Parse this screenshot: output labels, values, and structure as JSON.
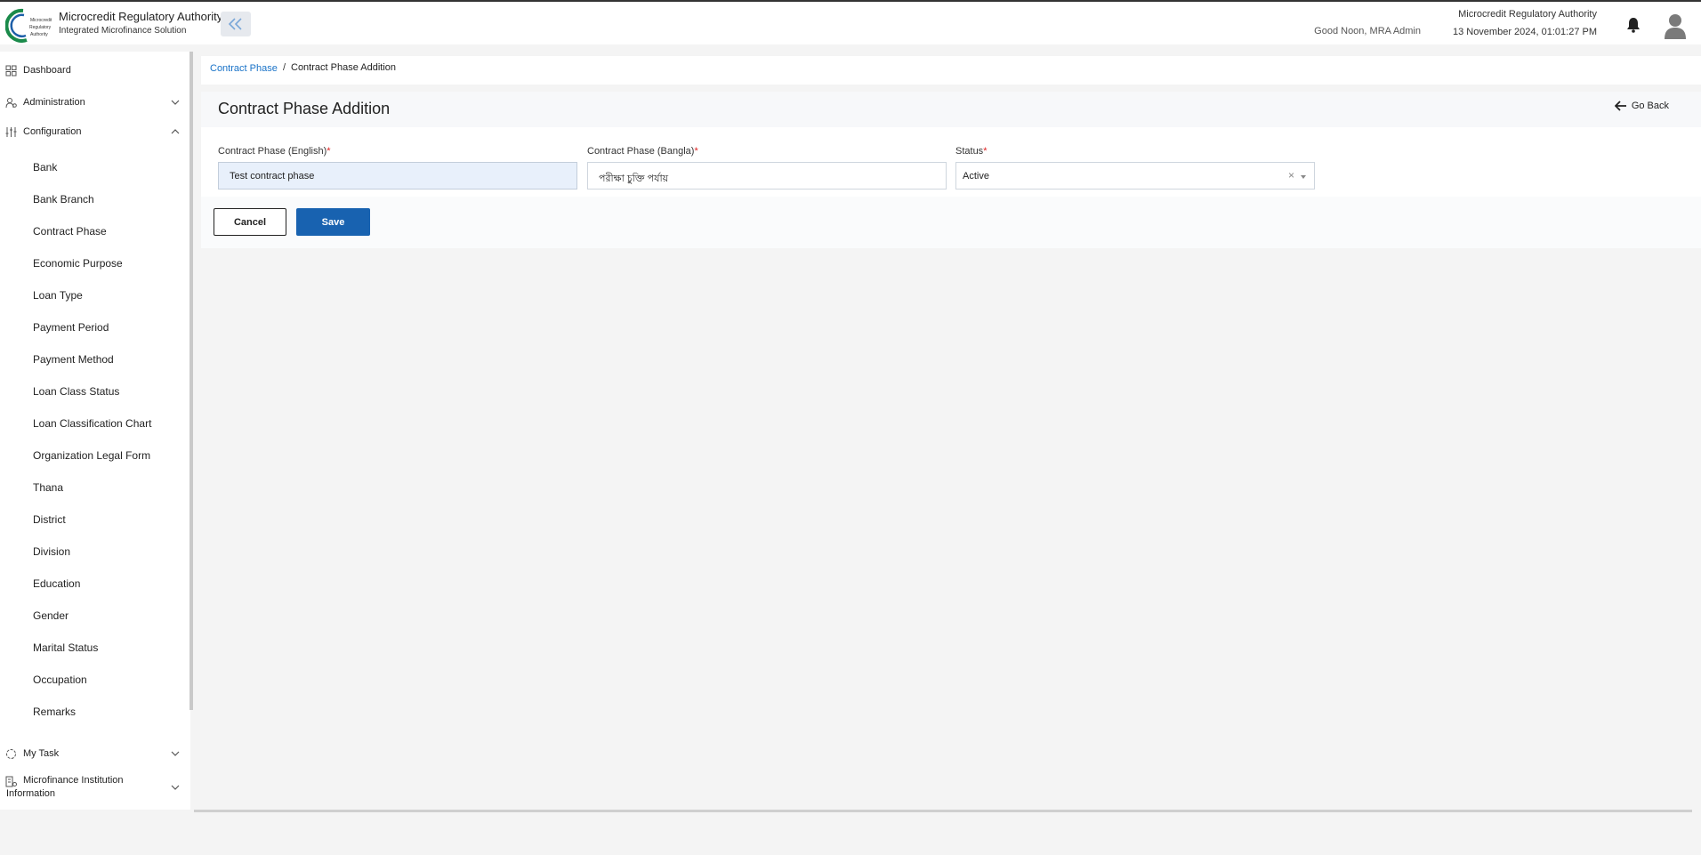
{
  "header": {
    "app_title": "Microcredit Regulatory Authority",
    "app_subtitle": "Integrated Microfinance Solution",
    "logo_text": "Microcredit Regulatory Authority",
    "greeting": "Good Noon, MRA Admin",
    "org_name": "Microcredit Regulatory Authority",
    "datetime": "13 November 2024, 01:01:27 PM"
  },
  "sidebar": {
    "dashboard": "Dashboard",
    "administration": "Administration",
    "configuration": "Configuration",
    "config_items": [
      "Bank",
      "Bank Branch",
      "Contract Phase",
      "Economic Purpose",
      "Loan Type",
      "Payment Period",
      "Payment Method",
      "Loan Class Status",
      "Loan Classification Chart",
      "Organization Legal Form",
      "Thana",
      "District",
      "Division",
      "Education",
      "Gender",
      "Marital Status",
      "Occupation",
      "Remarks"
    ],
    "my_task": "My Task",
    "mfi_info": "Microfinance Institution Information"
  },
  "breadcrumb": {
    "parent": "Contract Phase",
    "separator": "/",
    "current": "Contract Phase Addition"
  },
  "page": {
    "title": "Contract Phase Addition",
    "go_back": "Go Back"
  },
  "form": {
    "english_label": "Contract Phase (English)",
    "english_value": "Test contract phase",
    "bangla_label": "Contract Phase (Bangla)",
    "bangla_value": "পরীক্ষা চুক্তি পর্যায়",
    "status_label": "Status",
    "status_value": "Active",
    "required_mark": "*",
    "clear_symbol": "×"
  },
  "buttons": {
    "cancel": "Cancel",
    "save": "Save"
  },
  "colors": {
    "accent": "#1862b0",
    "link": "#1a73c8",
    "required": "#e02424",
    "logo_green": "#1a8a4a"
  }
}
